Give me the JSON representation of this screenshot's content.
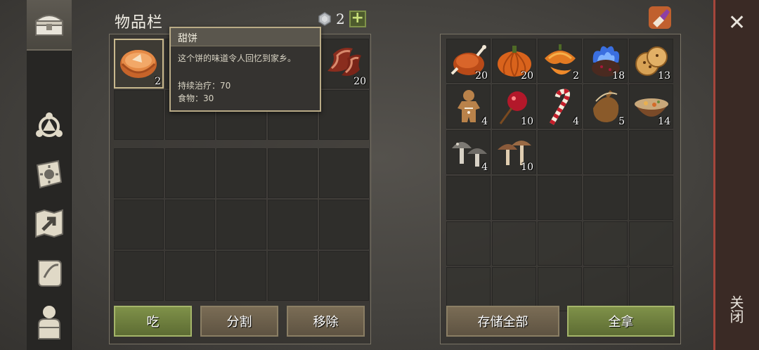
{
  "title": "物品栏",
  "currency": {
    "count": "2",
    "icon": "gem-icon",
    "plus": "+"
  },
  "tooltip": {
    "name": "甜饼",
    "description": "这个饼的味道令人回忆到家乡。",
    "stat1": "持续治疗：70",
    "stat2": "食物：30"
  },
  "inventory": {
    "items": [
      {
        "name": "pie",
        "count": "2"
      },
      {
        "name": "bacon",
        "count": "20"
      }
    ]
  },
  "storage": {
    "items": [
      {
        "name": "roast-chicken",
        "count": "20"
      },
      {
        "name": "pumpkin",
        "count": "20"
      },
      {
        "name": "pumpkin-slices",
        "count": "2"
      },
      {
        "name": "blue-flame-pudding",
        "count": "18"
      },
      {
        "name": "cookies",
        "count": "13"
      },
      {
        "name": "gingerbread",
        "count": "4"
      },
      {
        "name": "candy-apple",
        "count": "10"
      },
      {
        "name": "candy-cane",
        "count": "4"
      },
      {
        "name": "waterskin",
        "count": "5"
      },
      {
        "name": "stew-bowl",
        "count": "14"
      },
      {
        "name": "gray-mushrooms",
        "count": "4"
      },
      {
        "name": "brown-mushrooms",
        "count": "10"
      }
    ]
  },
  "buttons": {
    "eat": "吃",
    "split": "分割",
    "remove": "移除",
    "store_all": "存储全部",
    "take_all": "全拿"
  },
  "close": {
    "label": "关闭",
    "x": "✕"
  },
  "colors": {
    "green_button": "#7f9149",
    "brown_button": "#7a6c55",
    "close_accent": "#a5463c"
  }
}
